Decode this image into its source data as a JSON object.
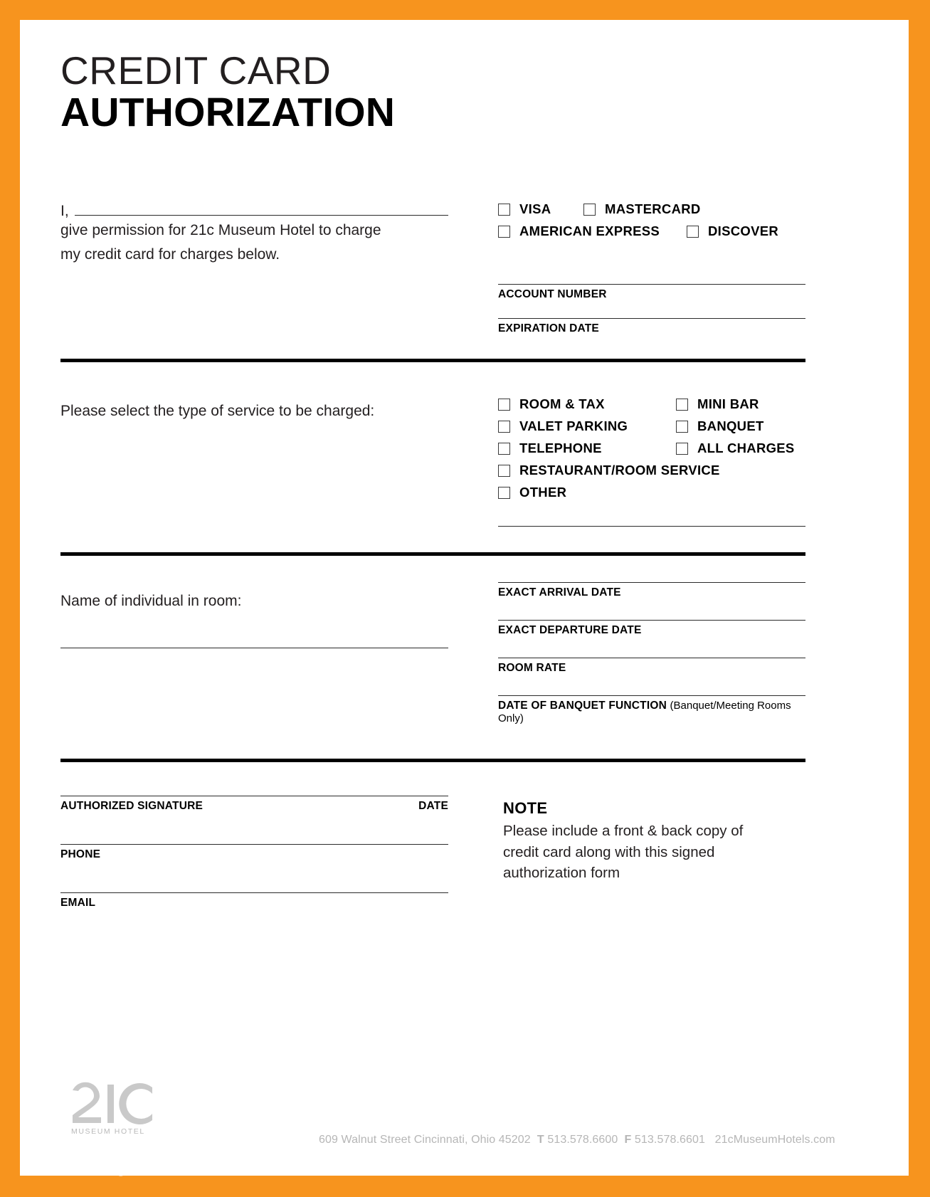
{
  "page": {
    "accent_color": "#F7941E",
    "background": "#ffffff",
    "watermark": "Gembloong.com"
  },
  "title": {
    "line1": "CREDIT CARD",
    "line2": "AUTHORIZATION"
  },
  "authorization": {
    "i_prefix": "I,",
    "body_line1": "give permission for 21c Museum Hotel to charge",
    "body_line2": "my credit card for charges below.",
    "card_types": [
      "VISA",
      "MASTERCARD",
      "AMERICAN EXPRESS",
      "DISCOVER"
    ],
    "account_number_label": "ACCOUNT NUMBER",
    "expiration_date_label": "EXPIRATION DATE"
  },
  "service": {
    "prompt": "Please select the type of service to be charged:",
    "options_col1": [
      "ROOM & TAX",
      "VALET PARKING",
      "TELEPHONE",
      "RESTAURANT/ROOM SERVICE",
      "OTHER"
    ],
    "options_col2": [
      "MINI BAR",
      "BANQUET",
      "ALL CHARGES"
    ]
  },
  "guest": {
    "name_prompt": "Name of individual in room:",
    "arrival_label": "EXACT ARRIVAL DATE",
    "departure_label": "EXACT DEPARTURE DATE",
    "room_rate_label": "ROOM RATE",
    "banquet_label": "DATE OF BANQUET FUNCTION",
    "banquet_note": "(Banquet/Meeting Rooms Only)"
  },
  "signature": {
    "authorized_signature_label": "AUTHORIZED SIGNATURE",
    "date_label": "DATE",
    "phone_label": "PHONE",
    "email_label": "EMAIL"
  },
  "note": {
    "heading": "NOTE",
    "line1": "Please include a front & back copy of",
    "line2": "credit card along with this signed",
    "line3": "authorization form"
  },
  "footer": {
    "logo_mark": "21c",
    "logo_sub": "MUSEUM HOTEL",
    "address": "609 Walnut Street  Cincinnati, Ohio 45202",
    "phone_prefix": "T",
    "phone": "513.578.6600",
    "fax_prefix": "F",
    "fax": "513.578.6601",
    "website": "21cMuseumHotels.com"
  }
}
